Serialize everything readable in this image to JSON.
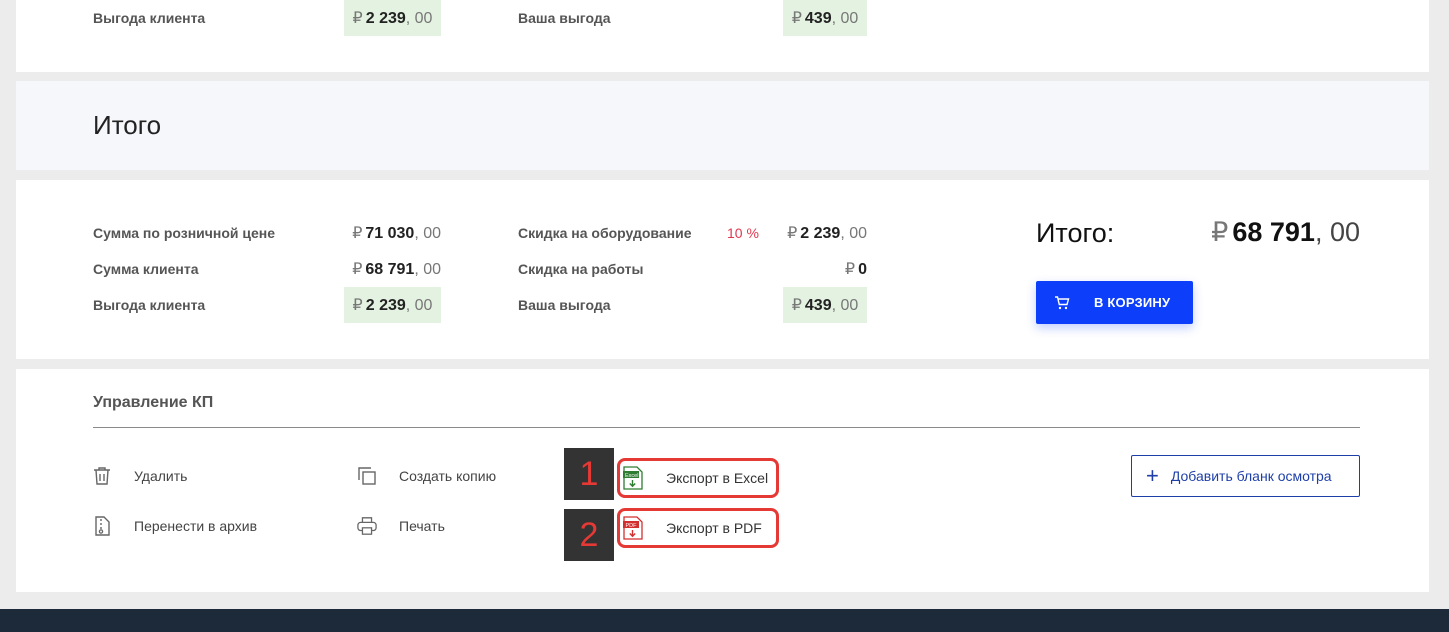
{
  "top_card": {
    "client_benefit_label": "Выгода клиента",
    "client_benefit": {
      "cur": "₽",
      "main": "2 239",
      "dec": ", 00"
    },
    "your_benefit_label": "Ваша выгода",
    "your_benefit": {
      "cur": "₽",
      "main": "439",
      "dec": ", 00"
    }
  },
  "title_band": {
    "title": "Итого"
  },
  "summary": {
    "retail_sum_label": "Сумма по розничной цене",
    "retail_sum": {
      "cur": "₽",
      "main": "71 030",
      "dec": ", 00"
    },
    "client_sum_label": "Сумма клиента",
    "client_sum": {
      "cur": "₽",
      "main": "68 791",
      "dec": ", 00"
    },
    "client_benefit_label": "Выгода клиента",
    "client_benefit": {
      "cur": "₽",
      "main": "2 239",
      "dec": ", 00"
    },
    "equipment_discount_label": "Скидка на оборудование",
    "equipment_discount_pct": "10 %",
    "equipment_discount": {
      "cur": "₽",
      "main": "2 239",
      "dec": ", 00"
    },
    "work_discount_label": "Скидка на работы",
    "work_discount": {
      "cur": "₽",
      "main": "0",
      "dec": ""
    },
    "your_benefit_label": "Ваша выгода",
    "your_benefit": {
      "cur": "₽",
      "main": "439",
      "dec": ", 00"
    },
    "total_label": "Итого:",
    "total": {
      "cur": "₽",
      "main": "68 791",
      "dec": ", 00"
    },
    "cart_button": "В КОРЗИНУ"
  },
  "management": {
    "title": "Управление КП",
    "delete": "Удалить",
    "archive": "Перенести в архив",
    "copy": "Создать копию",
    "print": "Печать",
    "export_excel": "Экспорт в Excel",
    "export_pdf": "Экспорт в PDF",
    "marker_1": "1",
    "marker_2": "2",
    "add_form": "Добавить бланк осмотра",
    "excel_icon_text": "Excel",
    "pdf_icon_text": "PDF"
  },
  "colors": {
    "accent_blue": "#0d3ffb",
    "highlight_green": "#e4f2e1",
    "discount_red": "#e0384f",
    "annotation_red": "#e53935",
    "footer": "#1c2a3a"
  }
}
